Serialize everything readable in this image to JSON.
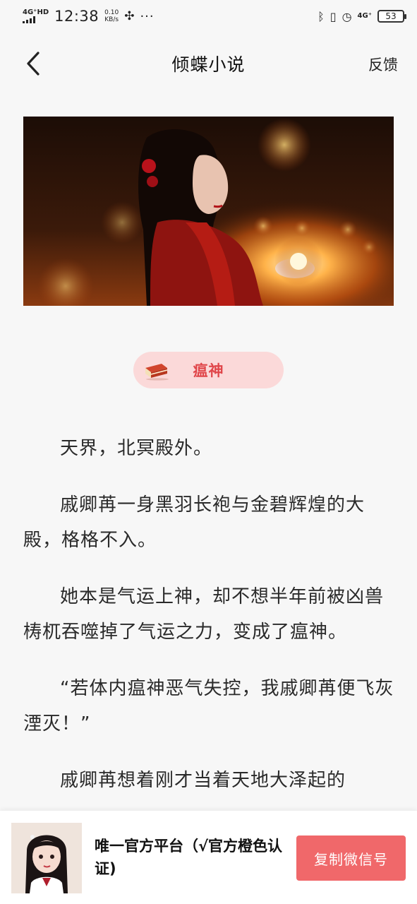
{
  "status_bar": {
    "network_label": "4G⁺HD",
    "time": "12:38",
    "speed_value": "0.10",
    "speed_unit": "KB/s",
    "more": "···",
    "network_right": "4G⁺",
    "battery": "53"
  },
  "nav": {
    "title": "倾蝶小说",
    "feedback_label": "反馈"
  },
  "book": {
    "title": "瘟神"
  },
  "content": {
    "paragraphs": [
      "天界，北冥殿外。",
      "戚卿苒一身黑羽长袍与金碧辉煌的大殿，格格不入。",
      "她本是气运上神，却不想半年前被凶兽梼杌吞噬掉了气运之力，变成了瘟神。",
      "“若体内瘟神恶气失控，我戚卿苒便飞灰湮灭！”",
      "戚卿苒想着刚才当着天地大泽起的"
    ]
  },
  "promo": {
    "text": "唯一官方平台（√官方橙色认证)",
    "button_label": "复制微信号"
  },
  "colors": {
    "accent": "#e0464a",
    "pill_bg": "#fbd9d9",
    "button_bg": "#f0686a",
    "page_bg": "#f7f7f7"
  },
  "icons": [
    "back-arrow-icon",
    "book-icon",
    "bluetooth-icon",
    "vibrate-icon",
    "alarm-icon",
    "battery-icon",
    "fan-icon"
  ]
}
